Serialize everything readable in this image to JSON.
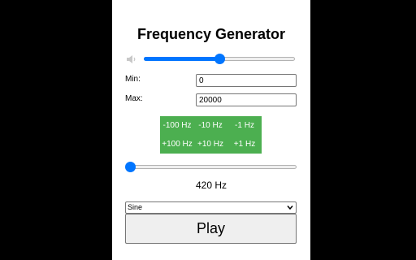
{
  "app": {
    "title": "Frequency Generator"
  },
  "volume": {
    "icon": "speaker-icon",
    "level_percent": 50
  },
  "min": {
    "label": "Min:",
    "value": "0"
  },
  "max": {
    "label": "Max:",
    "value": "20000"
  },
  "steps": {
    "color": "#4caf50",
    "buttons": [
      {
        "label": "-100 Hz"
      },
      {
        "label": "-10 Hz"
      },
      {
        "label": "-1 Hz"
      },
      {
        "label": "+100 Hz"
      },
      {
        "label": "+10 Hz"
      },
      {
        "label": "+1 Hz"
      }
    ]
  },
  "frequency": {
    "value_hz": 420,
    "display": "420 Hz",
    "min_hz": 0,
    "max_hz": 20000
  },
  "waveform": {
    "selected": "Sine",
    "icon": "chevron-down-icon"
  },
  "play": {
    "label": "Play"
  },
  "colors": {
    "accent": "#0075ff",
    "background": "#000000",
    "panel": "#ffffff"
  }
}
